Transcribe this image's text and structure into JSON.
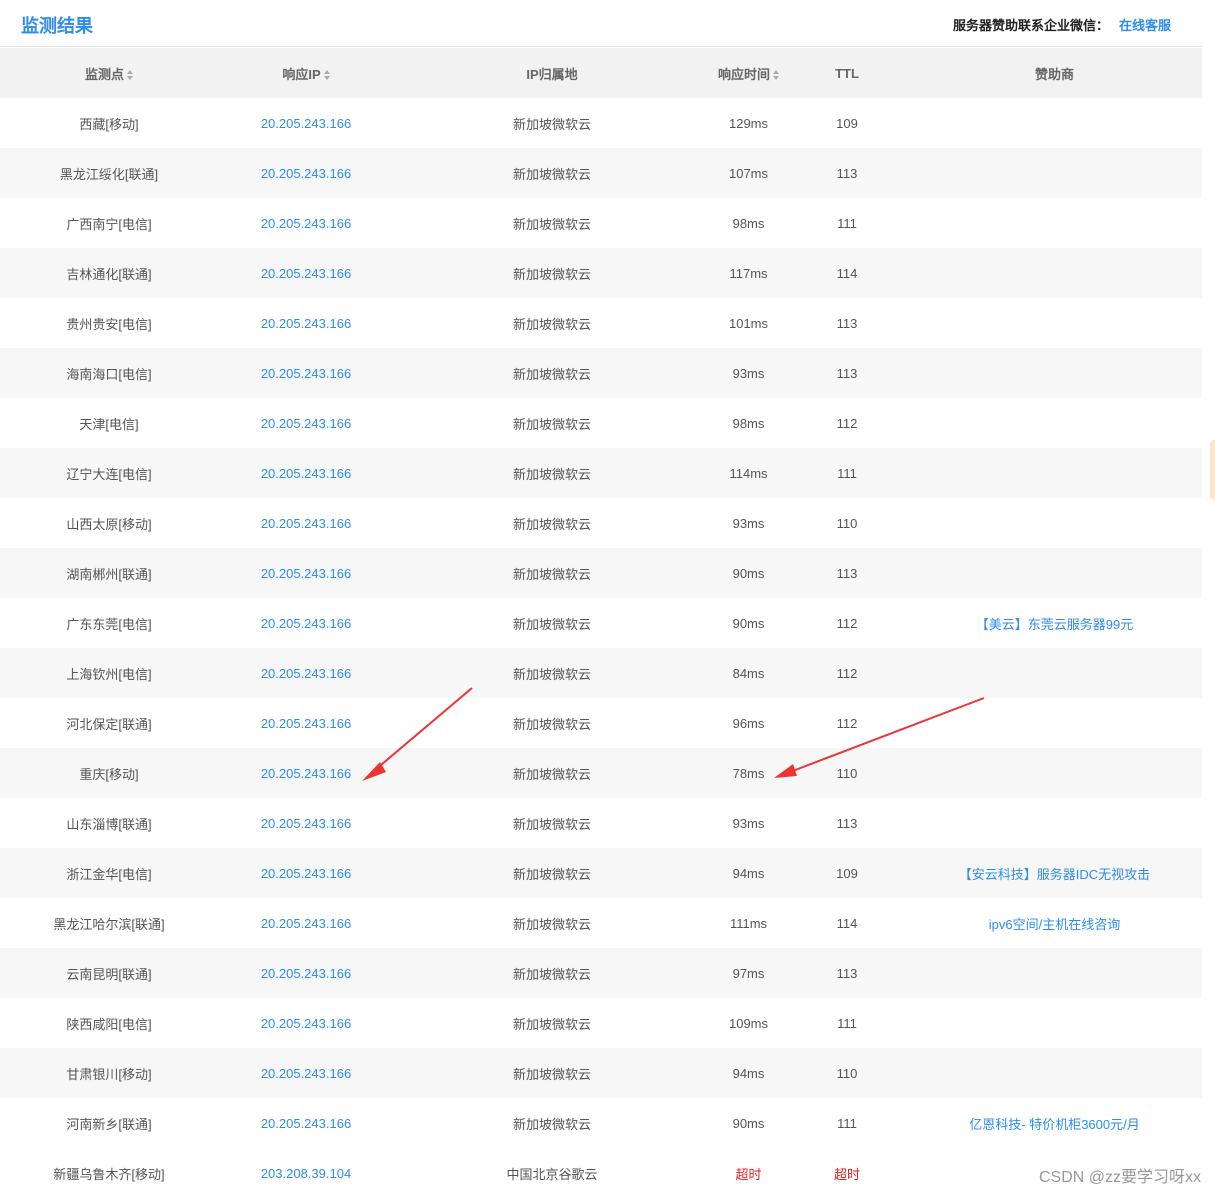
{
  "header": {
    "title": "监测结果",
    "sponsor_label": "服务器赞助联系企业微信：",
    "sponsor_link": "在线客服"
  },
  "columns": [
    "监测点",
    "响应IP",
    "IP归属地",
    "响应时间",
    "TTL",
    "赞助商"
  ],
  "rows": [
    {
      "point": "西藏[移动]",
      "ip": "20.205.243.166",
      "location": "新加坡微软云",
      "time": "129ms",
      "ttl": "109",
      "sponsor": ""
    },
    {
      "point": "黑龙江绥化[联通]",
      "ip": "20.205.243.166",
      "location": "新加坡微软云",
      "time": "107ms",
      "ttl": "113",
      "sponsor": ""
    },
    {
      "point": "广西南宁[电信]",
      "ip": "20.205.243.166",
      "location": "新加坡微软云",
      "time": "98ms",
      "ttl": "111",
      "sponsor": ""
    },
    {
      "point": "吉林通化[联通]",
      "ip": "20.205.243.166",
      "location": "新加坡微软云",
      "time": "117ms",
      "ttl": "114",
      "sponsor": ""
    },
    {
      "point": "贵州贵安[电信]",
      "ip": "20.205.243.166",
      "location": "新加坡微软云",
      "time": "101ms",
      "ttl": "113",
      "sponsor": ""
    },
    {
      "point": "海南海口[电信]",
      "ip": "20.205.243.166",
      "location": "新加坡微软云",
      "time": "93ms",
      "ttl": "113",
      "sponsor": ""
    },
    {
      "point": "天津[电信]",
      "ip": "20.205.243.166",
      "location": "新加坡微软云",
      "time": "98ms",
      "ttl": "112",
      "sponsor": ""
    },
    {
      "point": "辽宁大连[电信]",
      "ip": "20.205.243.166",
      "location": "新加坡微软云",
      "time": "114ms",
      "ttl": "111",
      "sponsor": ""
    },
    {
      "point": "山西太原[移动]",
      "ip": "20.205.243.166",
      "location": "新加坡微软云",
      "time": "93ms",
      "ttl": "110",
      "sponsor": ""
    },
    {
      "point": "湖南郴州[联通]",
      "ip": "20.205.243.166",
      "location": "新加坡微软云",
      "time": "90ms",
      "ttl": "113",
      "sponsor": ""
    },
    {
      "point": "广东东莞[电信]",
      "ip": "20.205.243.166",
      "location": "新加坡微软云",
      "time": "90ms",
      "ttl": "112",
      "sponsor": "【美云】东莞云服务器99元"
    },
    {
      "point": "上海钦州[电信]",
      "ip": "20.205.243.166",
      "location": "新加坡微软云",
      "time": "84ms",
      "ttl": "112",
      "sponsor": ""
    },
    {
      "point": "河北保定[联通]",
      "ip": "20.205.243.166",
      "location": "新加坡微软云",
      "time": "96ms",
      "ttl": "112",
      "sponsor": ""
    },
    {
      "point": "重庆[移动]",
      "ip": "20.205.243.166",
      "location": "新加坡微软云",
      "time": "78ms",
      "ttl": "110",
      "sponsor": ""
    },
    {
      "point": "山东淄博[联通]",
      "ip": "20.205.243.166",
      "location": "新加坡微软云",
      "time": "93ms",
      "ttl": "113",
      "sponsor": ""
    },
    {
      "point": "浙江金华[电信]",
      "ip": "20.205.243.166",
      "location": "新加坡微软云",
      "time": "94ms",
      "ttl": "109",
      "sponsor": "【安云科技】服务器IDC无视攻击"
    },
    {
      "point": "黑龙江哈尔滨[联通]",
      "ip": "20.205.243.166",
      "location": "新加坡微软云",
      "time": "111ms",
      "ttl": "114",
      "sponsor": "ipv6空间/主机在线咨询"
    },
    {
      "point": "云南昆明[联通]",
      "ip": "20.205.243.166",
      "location": "新加坡微软云",
      "time": "97ms",
      "ttl": "113",
      "sponsor": ""
    },
    {
      "point": "陕西咸阳[电信]",
      "ip": "20.205.243.166",
      "location": "新加坡微软云",
      "time": "109ms",
      "ttl": "111",
      "sponsor": ""
    },
    {
      "point": "甘肃银川[移动]",
      "ip": "20.205.243.166",
      "location": "新加坡微软云",
      "time": "94ms",
      "ttl": "110",
      "sponsor": ""
    },
    {
      "point": "河南新乡[联通]",
      "ip": "20.205.243.166",
      "location": "新加坡微软云",
      "time": "90ms",
      "ttl": "111",
      "sponsor": "亿恩科技- 特价机柜3600元/月"
    },
    {
      "point": "新疆乌鲁木齐[移动]",
      "ip": "203.208.39.104",
      "location": "中国北京谷歌云",
      "time": "超时",
      "ttl": "超时",
      "sponsor": "",
      "timeout": true
    }
  ],
  "watermark": "CSDN @zz要学习呀xx",
  "colors": {
    "accent": "#2d8cf0",
    "timeout": "#e02020",
    "annotation_arrow": "#ee3333"
  }
}
